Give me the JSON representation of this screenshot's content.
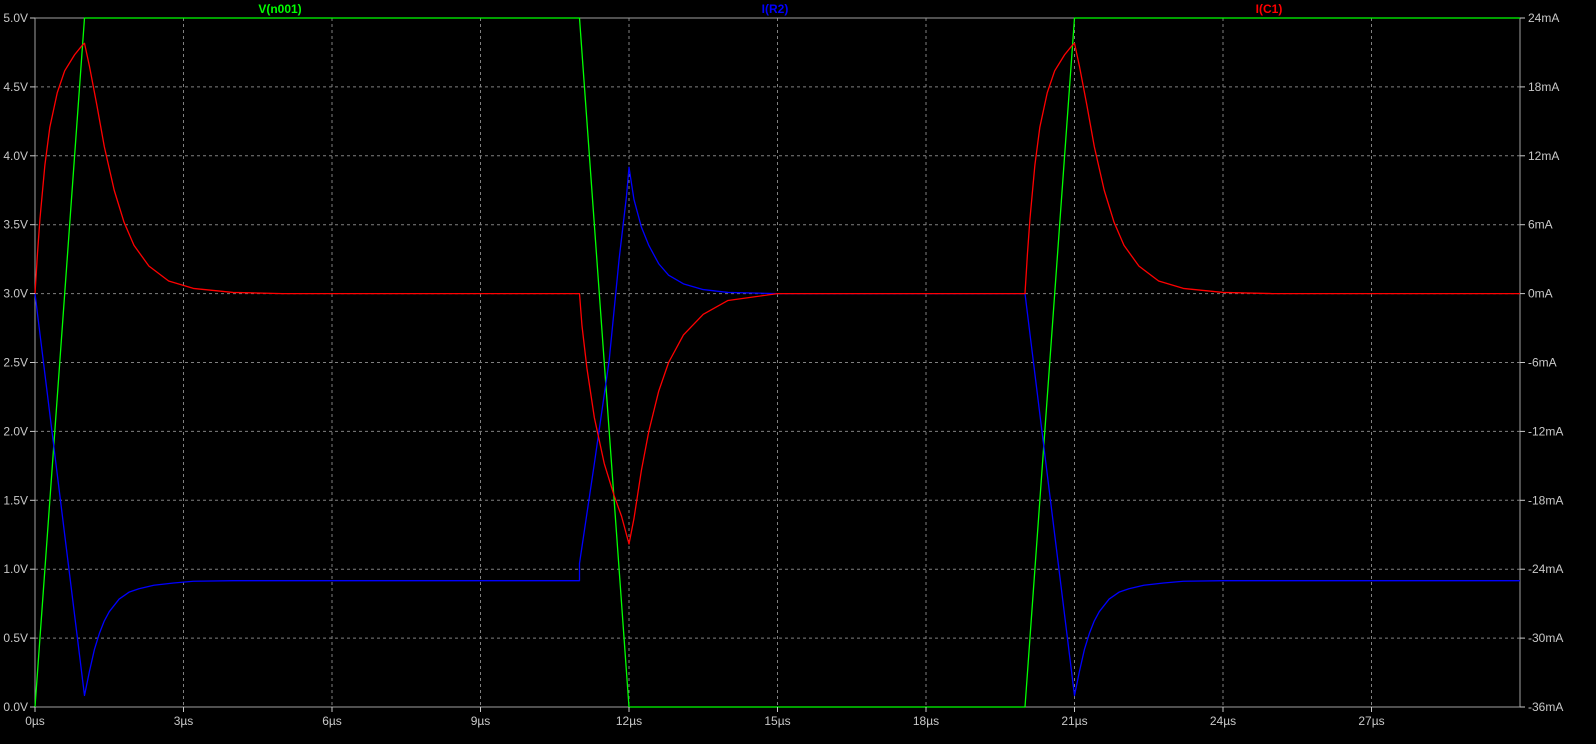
{
  "chart_data": {
    "type": "line",
    "grid": true,
    "x_unit": "µs",
    "x_range": [
      0,
      30
    ],
    "x_ticks": [
      0,
      3,
      6,
      9,
      12,
      15,
      18,
      21,
      24,
      27
    ],
    "x_tick_labels": [
      "0µs",
      "3µs",
      "6µs",
      "9µs",
      "12µs",
      "15µs",
      "18µs",
      "21µs",
      "24µs",
      "27µs"
    ],
    "left_axis": {
      "range": [
        0,
        5
      ],
      "ticks": [
        0,
        0.5,
        1,
        1.5,
        2,
        2.5,
        3,
        3.5,
        4,
        4.5,
        5
      ],
      "tick_labels": [
        "0.0V",
        "0.5V",
        "1.0V",
        "1.5V",
        "2.0V",
        "2.5V",
        "3.0V",
        "3.5V",
        "4.0V",
        "4.5V",
        "5.0V"
      ]
    },
    "right_axis": {
      "range": [
        -36,
        24
      ],
      "ticks": [
        -36,
        -30,
        -24,
        -18,
        -12,
        -6,
        0,
        6,
        12,
        18,
        24
      ],
      "tick_labels": [
        "-36mA",
        "-30mA",
        "-24mA",
        "-18mA",
        "-12mA",
        "-6mA",
        "0mA",
        "6mA",
        "12mA",
        "18mA",
        "24mA"
      ]
    },
    "series": [
      {
        "name": "V(n001)",
        "axis": "left",
        "color": "#00ff00",
        "points": [
          [
            0,
            0
          ],
          [
            1,
            5
          ],
          [
            11,
            5
          ],
          [
            12,
            0
          ],
          [
            20,
            0
          ],
          [
            21,
            5
          ],
          [
            30,
            5
          ]
        ]
      },
      {
        "name": "I(R2)",
        "axis": "right",
        "color": "#0000ff",
        "points": [
          [
            0,
            0
          ],
          [
            0.1,
            -3.5
          ],
          [
            0.3,
            -10.5
          ],
          [
            0.5,
            -17.5
          ],
          [
            0.7,
            -24.5
          ],
          [
            0.9,
            -31.5
          ],
          [
            1,
            -35
          ],
          [
            1.1,
            -32.9
          ],
          [
            1.2,
            -31.0
          ],
          [
            1.3,
            -29.6
          ],
          [
            1.4,
            -28.5
          ],
          [
            1.5,
            -27.7
          ],
          [
            1.7,
            -26.6
          ],
          [
            1.9,
            -26.0
          ],
          [
            2.1,
            -25.7
          ],
          [
            2.4,
            -25.4
          ],
          [
            2.8,
            -25.2
          ],
          [
            3.2,
            -25.05
          ],
          [
            4,
            -25
          ],
          [
            11,
            -25
          ],
          [
            11,
            -23.5
          ],
          [
            11.3,
            -14.8
          ],
          [
            11.6,
            -5.8
          ],
          [
            11.8,
            3.0
          ],
          [
            11.95,
            8.5
          ],
          [
            12,
            11
          ],
          [
            12.1,
            8.2
          ],
          [
            12.25,
            5.8
          ],
          [
            12.4,
            4.2
          ],
          [
            12.6,
            2.6
          ],
          [
            12.8,
            1.6
          ],
          [
            13.1,
            0.85
          ],
          [
            13.5,
            0.35
          ],
          [
            14,
            0.1
          ],
          [
            15,
            0
          ],
          [
            20,
            0
          ],
          [
            20.1,
            -3.5
          ],
          [
            20.3,
            -10.5
          ],
          [
            20.5,
            -17.5
          ],
          [
            20.7,
            -24.5
          ],
          [
            20.9,
            -31.5
          ],
          [
            21,
            -35
          ],
          [
            21.1,
            -32.9
          ],
          [
            21.2,
            -31.0
          ],
          [
            21.3,
            -29.6
          ],
          [
            21.4,
            -28.5
          ],
          [
            21.5,
            -27.7
          ],
          [
            21.7,
            -26.6
          ],
          [
            21.9,
            -26.0
          ],
          [
            22.1,
            -25.7
          ],
          [
            22.4,
            -25.4
          ],
          [
            22.8,
            -25.2
          ],
          [
            23.2,
            -25.05
          ],
          [
            24,
            -25
          ],
          [
            30,
            -25
          ]
        ]
      },
      {
        "name": "I(C1)",
        "axis": "right",
        "color": "#ff0000",
        "points": [
          [
            0,
            0
          ],
          [
            0.05,
            3.5
          ],
          [
            0.1,
            6.5
          ],
          [
            0.2,
            11.2
          ],
          [
            0.3,
            14.5
          ],
          [
            0.45,
            17.5
          ],
          [
            0.6,
            19.4
          ],
          [
            0.8,
            20.8
          ],
          [
            0.95,
            21.6
          ],
          [
            1,
            21.8
          ],
          [
            1.1,
            19.8
          ],
          [
            1.25,
            16.4
          ],
          [
            1.4,
            12.8
          ],
          [
            1.6,
            9.0
          ],
          [
            1.8,
            6.2
          ],
          [
            2,
            4.2
          ],
          [
            2.3,
            2.4
          ],
          [
            2.7,
            1.1
          ],
          [
            3.2,
            0.45
          ],
          [
            4,
            0.1
          ],
          [
            5,
            0
          ],
          [
            11,
            0
          ],
          [
            11.05,
            -2.8
          ],
          [
            11.15,
            -6.5
          ],
          [
            11.3,
            -10.8
          ],
          [
            11.5,
            -14.8
          ],
          [
            11.7,
            -17.6
          ],
          [
            11.85,
            -19.4
          ],
          [
            12,
            -21.8
          ],
          [
            12.1,
            -19.6
          ],
          [
            12.25,
            -15.4
          ],
          [
            12.4,
            -12.0
          ],
          [
            12.6,
            -8.5
          ],
          [
            12.8,
            -6.0
          ],
          [
            13.1,
            -3.6
          ],
          [
            13.5,
            -1.8
          ],
          [
            14,
            -0.6
          ],
          [
            15,
            0
          ],
          [
            20,
            0
          ],
          [
            20.05,
            3.5
          ],
          [
            20.1,
            6.5
          ],
          [
            20.2,
            11.2
          ],
          [
            20.3,
            14.5
          ],
          [
            20.45,
            17.5
          ],
          [
            20.6,
            19.4
          ],
          [
            20.8,
            20.8
          ],
          [
            20.95,
            21.6
          ],
          [
            21,
            21.8
          ],
          [
            21.1,
            19.8
          ],
          [
            21.25,
            16.4
          ],
          [
            21.4,
            12.8
          ],
          [
            21.6,
            9.0
          ],
          [
            21.8,
            6.2
          ],
          [
            22,
            4.2
          ],
          [
            22.3,
            2.4
          ],
          [
            22.7,
            1.1
          ],
          [
            23.2,
            0.45
          ],
          [
            24,
            0.1
          ],
          [
            25,
            0
          ],
          [
            30,
            0
          ]
        ]
      }
    ]
  }
}
